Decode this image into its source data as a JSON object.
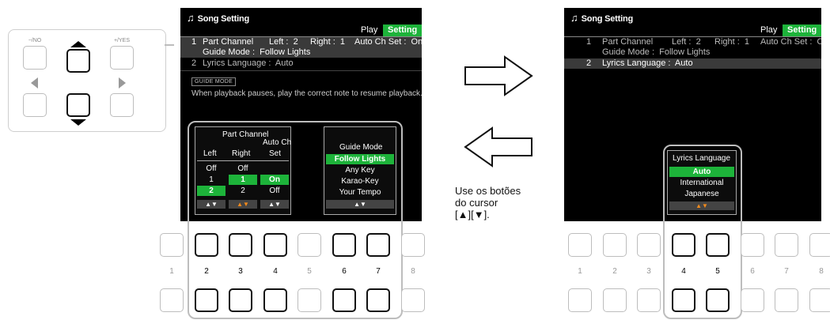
{
  "screen_title": "Song Setting",
  "tabs": {
    "play": "Play",
    "setting": "Setting"
  },
  "left_screen": {
    "rows": [
      {
        "num": "1",
        "text": "Part Channel",
        "left": "Left :  2",
        "right": "Right :  1",
        "auto": "Auto Ch Set :  On"
      },
      {
        "num": "",
        "text": "Guide Mode :  Follow Lights"
      },
      {
        "num": "2",
        "text": "Lyrics Language :  Auto"
      }
    ],
    "guide_tag": "GUIDE MODE",
    "guide_text": "When playback pauses, play the correct note to resume playback."
  },
  "part_channel_popup": {
    "title": "Part Channel",
    "col_left": "Left",
    "col_right": "Right",
    "col_auto": [
      "Auto Ch",
      "Set"
    ],
    "col_guide": "Guide Mode",
    "left_values": [
      "Off",
      "1",
      "2"
    ],
    "right_values": [
      "Off",
      "1",
      "2"
    ],
    "auto_values": [
      "On",
      "Off"
    ],
    "guide_values": [
      "Follow Lights",
      "Any Key",
      "Karao-Key",
      "Your Tempo"
    ],
    "arrows": "▲▼"
  },
  "right_screen": {
    "rows": [
      {
        "num": "1",
        "text": "Part Channel",
        "left": "Left :  2",
        "right": "Right :  1",
        "auto": "Auto Ch Set :  On"
      },
      {
        "num": "",
        "text": "Guide Mode :  Follow Lights"
      },
      {
        "num": "2",
        "text": "Lyrics Language :  Auto"
      }
    ]
  },
  "lyrics_popup": {
    "title": "Lyrics Language",
    "values": [
      "Auto",
      "International",
      "Japanese"
    ],
    "arrows": "▲▼"
  },
  "cursor_buttons": {
    "no_label": "−/NO",
    "yes_label": "+/YES"
  },
  "left_button_numbers": [
    "1",
    "2",
    "3",
    "4",
    "5",
    "6",
    "7",
    "8"
  ],
  "right_button_numbers": [
    "1",
    "2",
    "3",
    "4",
    "5",
    "6",
    "7",
    "8"
  ],
  "caption": [
    "Use os botões",
    "do cursor",
    "[▲][▼]."
  ],
  "colors": {
    "accent_green": "#1db33a",
    "arrow_orange": "#f28a1c",
    "lcd_bg": "#000000"
  }
}
